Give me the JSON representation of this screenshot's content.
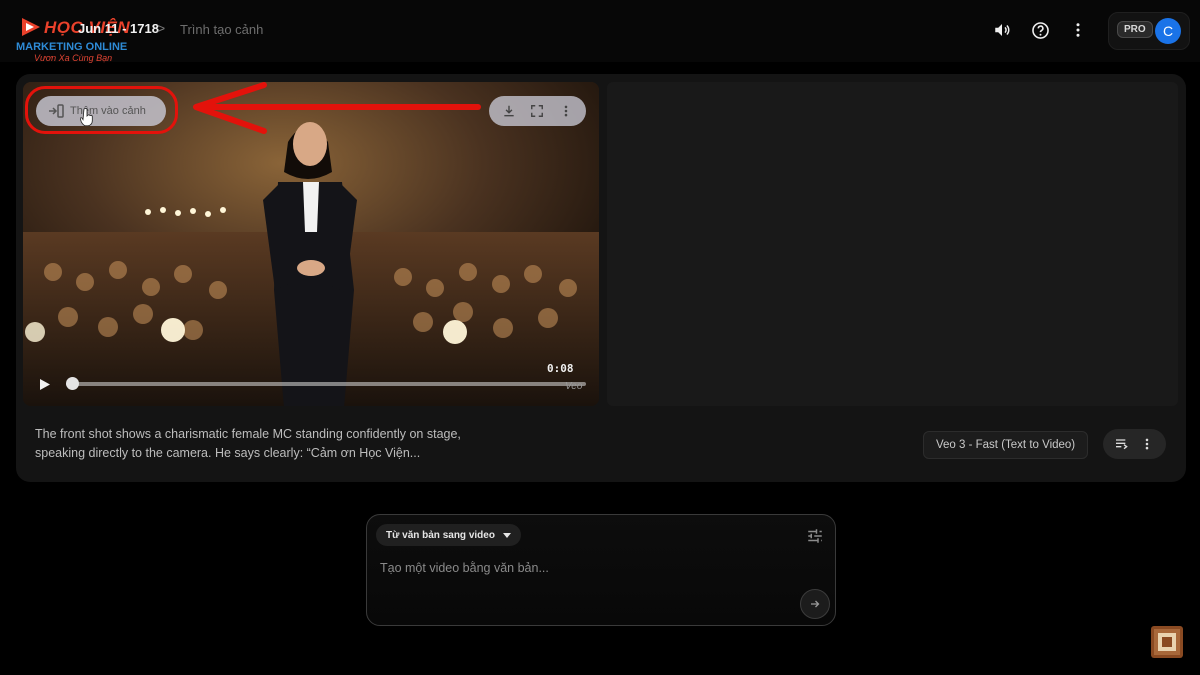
{
  "brand": {
    "logo_line1": "HỌC VIỆN",
    "logo_line2": "MARKETING ONLINE",
    "logo_slogan": "Vươn Xa Cùng Bạn"
  },
  "breadcrumb": {
    "project": "Jun 11 - 1718",
    "separator": ">",
    "current": "Trình tạo cảnh"
  },
  "header": {
    "icons": [
      "volume-icon",
      "help-icon",
      "more-vert-icon"
    ],
    "pro_badge": "PRO",
    "avatar_initial": "C"
  },
  "video": {
    "add_to_scene_label": "Thêm vào cảnh",
    "actions": [
      "download-icon",
      "fullscreen-icon",
      "more-vert-icon"
    ],
    "timecode": "0:08",
    "watermark": "Veo",
    "progress": 0.0
  },
  "generation": {
    "prompt_text": "The front shot shows a charismatic female MC standing confidently on stage, speaking directly to the camera. He says clearly: “Cảm ơn Học Viện...",
    "model": "Veo 3 - Fast (Text to Video)"
  },
  "composer": {
    "mode": "Từ văn bản sang video",
    "placeholder": "Tạo một video bằng văn bản..."
  },
  "colors": {
    "highlight": "#e3120b",
    "avatar": "#1a73e8",
    "background": "#000000"
  }
}
